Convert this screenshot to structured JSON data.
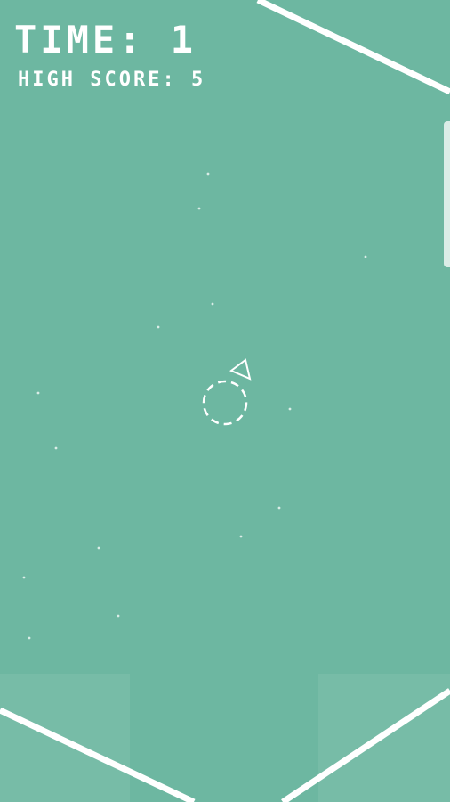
{
  "hud": {
    "time_label": "TIME",
    "time_value": "1",
    "high_score_label": "HIGH SCORE",
    "high_score_value": "5"
  },
  "colors": {
    "background": "#6db7a1",
    "foreground": "#ffffff"
  },
  "icons": {
    "player": "triangle-ship-icon",
    "spawn": "dashed-circle-icon"
  }
}
